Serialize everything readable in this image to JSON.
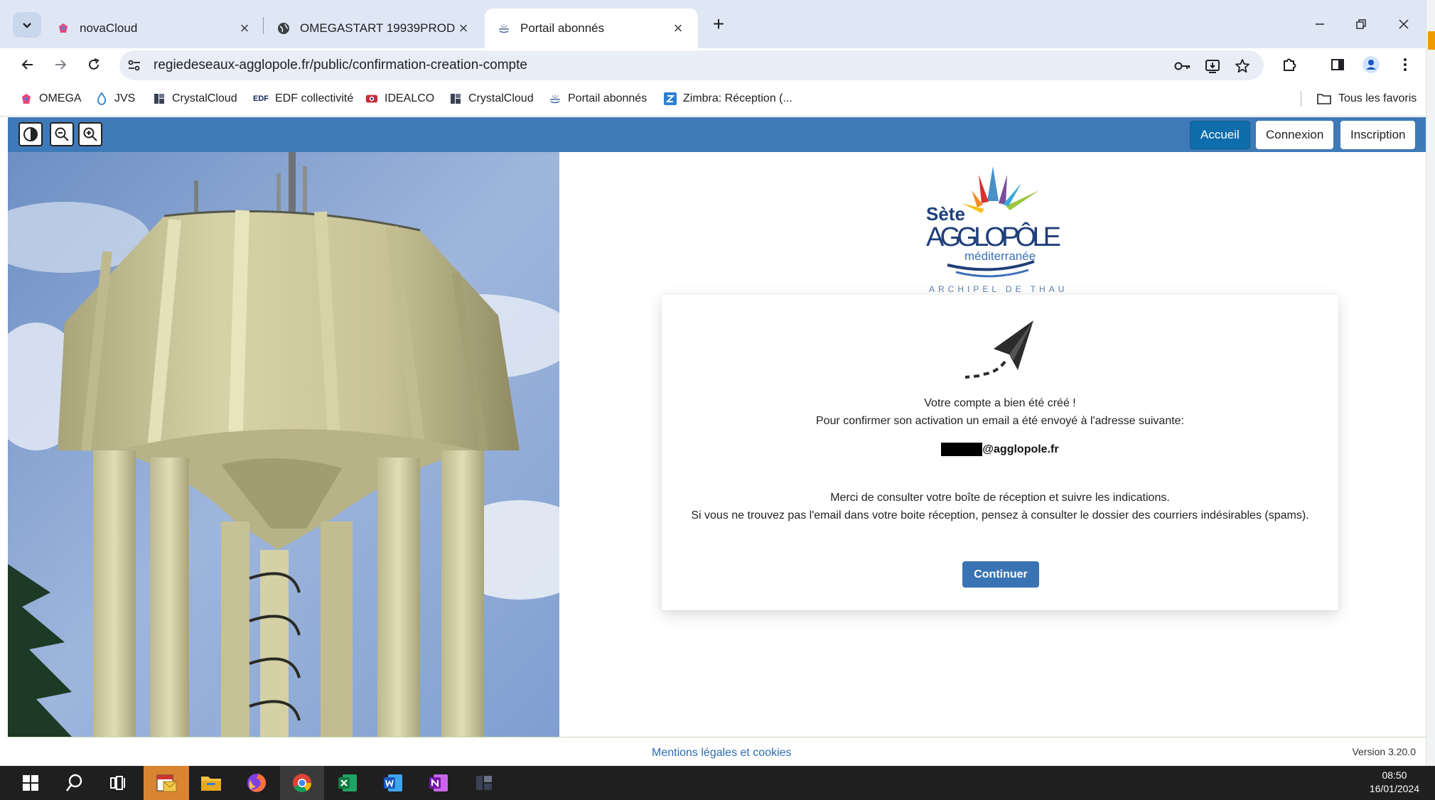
{
  "browser": {
    "tabs": [
      {
        "label": "novaCloud",
        "active": false
      },
      {
        "label": "OMEGASTART 19939PROD",
        "active": false
      },
      {
        "label": "Portail abonnés",
        "active": true
      }
    ],
    "url": "regiedeseaux-agglopole.fr/public/confirmation-creation-compte",
    "bookmarks": [
      {
        "label": "OMEGA"
      },
      {
        "label": "JVS"
      },
      {
        "label": "CrystalCloud"
      },
      {
        "label": "EDF collectivité"
      },
      {
        "label": "IDEALCO"
      },
      {
        "label": "CrystalCloud"
      },
      {
        "label": "Portail abonnés"
      },
      {
        "label": "Zimbra: Réception (..."
      }
    ],
    "all_bookmarks_label": "Tous les favoris"
  },
  "page": {
    "nav": {
      "home": "Accueil",
      "login": "Connexion",
      "signup": "Inscription"
    },
    "logo": {
      "line1": "Sète",
      "line2": "AGGLOPÔLE",
      "line3": "méditerranée",
      "line4": "ARCHIPEL DE THAU"
    },
    "card": {
      "line1": "Votre compte a bien été créé !",
      "line2": "Pour confirmer son activation un email a été envoyé à l'adresse suivante:",
      "email_domain": "@agglopole.fr",
      "line3": "Merci de consulter votre boîte de réception et suivre les indications.",
      "line4": "Si vous ne trouvez pas l'email dans votre boite réception, pensez à consulter le dossier des courriers indésirables (spams).",
      "continue": "Continuer"
    },
    "footer": {
      "legal": "Mentions légales et cookies",
      "version": "Version 3.20.0"
    }
  },
  "taskbar": {
    "time": "08:50",
    "date": "16/01/2024"
  }
}
